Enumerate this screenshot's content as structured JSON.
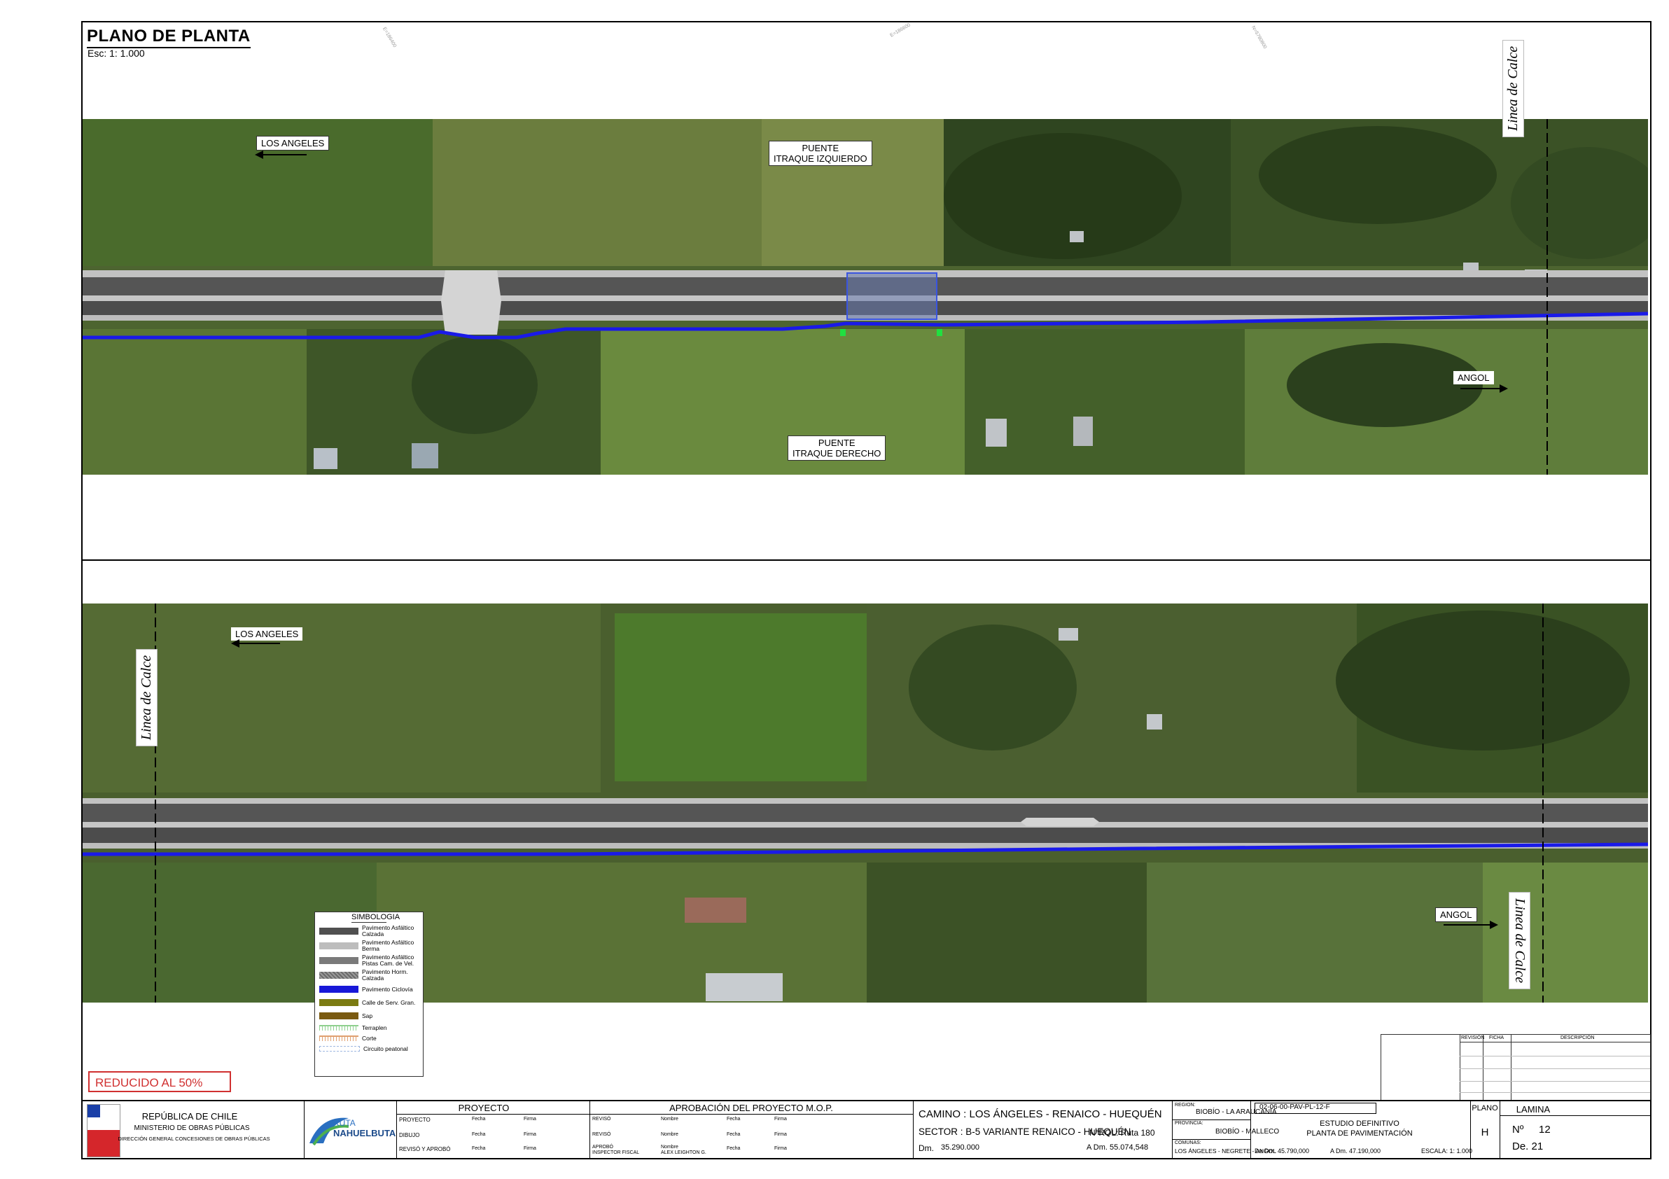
{
  "plan": {
    "title": "PLANO DE PLANTA",
    "scale": "Esc: 1: 1.000"
  },
  "top_view": {
    "los_angeles": "LOS ANGELES",
    "angol": "ANGOL",
    "puente_izq_1": "PUENTE",
    "puente_izq_2": "ITRAQUE IZQUIERDO",
    "puente_der_1": "PUENTE",
    "puente_der_2": "ITRAQUE DERECHO",
    "linea_calce": "Linea de Calce"
  },
  "bottom_view": {
    "los_angeles": "LOS ANGELES",
    "angol": "ANGOL",
    "linea_calce_left": "Linea de Calce",
    "linea_calce_right": "Linea de Calce"
  },
  "legend": {
    "title": "SIMBOLOGIA",
    "items": [
      {
        "label_1": "Pavimento Asfáltico",
        "label_2": "Calzada",
        "color": "#505050"
      },
      {
        "label_1": "Pavimento Asfáltico",
        "label_2": "Berma",
        "color": "#bdbdbd"
      },
      {
        "label_1": "Pavimento Asfáltico",
        "label_2": "Pistas Cam. de Vel.",
        "color": "#7a7a7a"
      },
      {
        "label_1": "Pavimento Horm.",
        "label_2": "Calzada",
        "color": "#8e8e8e"
      },
      {
        "label_1": "Pavimento Ciclovía",
        "label_2": "",
        "color": "#1818d8"
      },
      {
        "label_1": "Calle de Serv. Gran.",
        "label_2": "",
        "color": "#7b7b12"
      },
      {
        "label_1": "Sap",
        "label_2": "",
        "color": "#7a5a10"
      },
      {
        "label_1": "Terraplen",
        "label_2": "",
        "color": "#8fd08f"
      },
      {
        "label_1": "Corte",
        "label_2": "",
        "color": "#e0a070"
      },
      {
        "label_1": "Circuito peatonal",
        "label_2": "",
        "color": "#9fb8e0"
      }
    ]
  },
  "reduced": "REDUCIDO AL 50%",
  "revision_table": {
    "col_revision": "REVISIÓN",
    "col_ficha": "FICHA",
    "col_descripcion": "DESCRIPCIÓN"
  },
  "title_block": {
    "republica": "REPÚBLICA DE CHILE",
    "ministerio": "MINISTERIO DE OBRAS PÚBLICAS",
    "direccion": "DIRECCIÓN GENERAL CONCESIONES DE OBRAS PÚBLICAS",
    "logo_text_1": "RUTA",
    "logo_text_2": "NAHUELBUTA",
    "proyecto_header": "PROYECTO",
    "aprobacion_header": "APROBACIÓN DEL PROYECTO M.O.P.",
    "proyecto_rows": [
      "PROYECTO",
      "DIBUJO",
      "REVISÓ Y APROBÓ"
    ],
    "aprob_rows": [
      "REVISÓ",
      "REVISÓ",
      "APROBÓ"
    ],
    "inspector": "INSPECTOR FISCAL",
    "alex": "ALEX LEIGHTON G.",
    "fecha": "Fecha",
    "firma": "Firma",
    "nombre": "Nombre",
    "camino": "CAMINO : LOS ÁNGELES - RENAICO - HUEQUÉN",
    "sector": "SECTOR : B-5 VARIANTE RENAICO - HUEQUÉN",
    "rol": "N°ROL: Ruta 180",
    "dm_label": "Dm.",
    "dm_value": "35.290.000",
    "adm": "A Dm.  55.074,548",
    "region_label": "REGION:",
    "region_value": "BIOBÍO - LA ARAUCANÍA",
    "provincia_label": "PROVINCIA:",
    "provincia_value": "BIOBÍO - MALLECO",
    "comunas_label": "COMUNAS:",
    "comunas_value": "LOS ÁNGELES - NEGRETE - ANGOL",
    "code": "02-06-00-PAV-PL-12-F",
    "estudio": "ESTUDIO DEFINITIVO",
    "planta": "PLANTA DE PAVIMENTACIÓN",
    "de_dm": "De Dm. 45.790,000",
    "a_dm": "A Dm.  47.190,000",
    "escala": "ESCALA:  1: 1.000",
    "plano_label": "PLANO",
    "plano_value": "H",
    "lamina_label": "LAMINA",
    "num_label": "Nº",
    "num_value": "12",
    "de_value": "De. 21"
  }
}
